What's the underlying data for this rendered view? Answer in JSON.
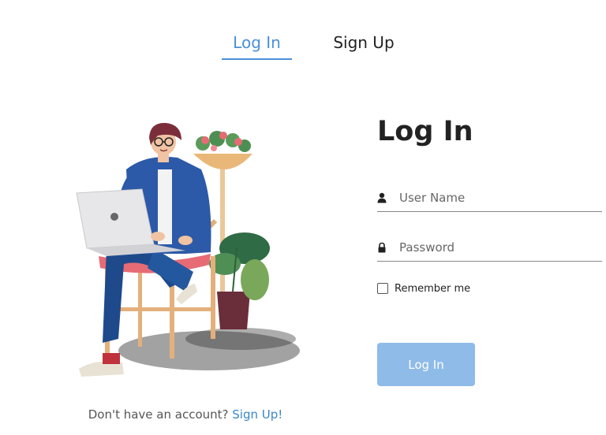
{
  "tabs": {
    "login_label": "Log In",
    "signup_label": "Sign Up",
    "active": "login"
  },
  "form": {
    "title": "Log In",
    "username_placeholder": "User Name",
    "password_placeholder": "Password",
    "remember_label": "Remember me",
    "remember_checked": false,
    "submit_label": "Log In"
  },
  "footer": {
    "prompt": "Don't have an account?",
    "link": "Sign Up!"
  },
  "icons": {
    "username": "user-icon",
    "password": "lock-icon"
  },
  "colors": {
    "accent": "#4a90d9",
    "button": "#8fbbe8",
    "link": "#3a86c8"
  }
}
